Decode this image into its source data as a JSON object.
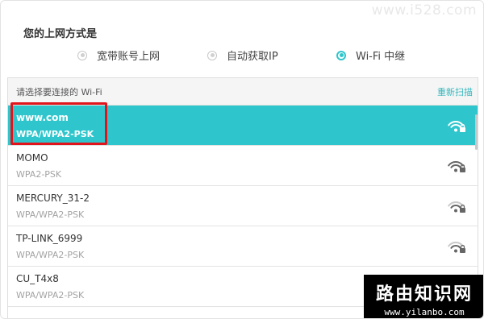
{
  "watermark_top": "www.i528.com",
  "title": "您的上网方式是",
  "modes": [
    {
      "label": "宽带账号上网",
      "selected": false
    },
    {
      "label": "自动获取IP",
      "selected": false
    },
    {
      "label": "Wi-Fi 中继",
      "selected": true
    }
  ],
  "list": {
    "header_label": "请选择要连接的 Wi-Fi",
    "rescan_label": "重新扫描",
    "networks": [
      {
        "ssid": "www.com",
        "security": "WPA/WPA2-PSK",
        "selected": true,
        "signal": 3,
        "locked": true
      },
      {
        "ssid": "MOMO",
        "security": "WPA2-PSK",
        "selected": false,
        "signal": 3,
        "locked": true
      },
      {
        "ssid": "MERCURY_31-2",
        "security": "WPA/WPA2-PSK",
        "selected": false,
        "signal": 2,
        "locked": true
      },
      {
        "ssid": "TP-LINK_6999",
        "security": "WPA/WPA2-PSK",
        "selected": false,
        "signal": 2,
        "locked": true
      },
      {
        "ssid": "CU_T4x8",
        "security": "WPA/WPA2-PSK",
        "selected": false,
        "signal": 2,
        "locked": true
      }
    ]
  },
  "badge": {
    "title": "路由知识网",
    "url": "www.yilanbo.com"
  },
  "colors": {
    "accent": "#2ec6cc",
    "highlight_box": "#e1141b",
    "rescan": "#35b7bd"
  },
  "icons": {
    "wifi": "wifi-lock-icon",
    "radio": "radio-icon"
  }
}
